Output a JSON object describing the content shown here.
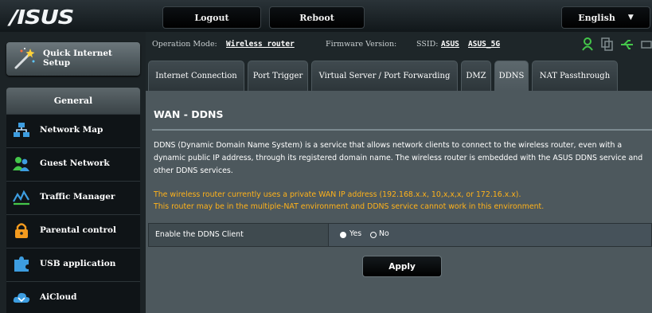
{
  "header": {
    "logo_text": "/ISUS",
    "logout_label": "Logout",
    "reboot_label": "Reboot",
    "language_label": "English",
    "language_arrow": "▼"
  },
  "sidebar": {
    "quick_setup_label": "Quick Internet Setup",
    "section_title": "General",
    "items": [
      {
        "label": "Network Map",
        "icon": "network-map-icon"
      },
      {
        "label": "Guest Network",
        "icon": "guest-network-icon"
      },
      {
        "label": "Traffic Manager",
        "icon": "traffic-manager-icon"
      },
      {
        "label": "Parental control",
        "icon": "parental-control-icon"
      },
      {
        "label": "USB application",
        "icon": "usb-application-icon"
      },
      {
        "label": "AiCloud",
        "icon": "aicloud-icon"
      }
    ]
  },
  "status": {
    "operation_mode_label": "Operation Mode:",
    "operation_mode_value": "Wireless router",
    "firmware_label": "Firmware Version:",
    "ssid_label": "SSID:",
    "ssid_value_1": "ASUS",
    "ssid_value_2": "ASUS_5G"
  },
  "tabs": [
    {
      "label": "Internet Connection",
      "active": false
    },
    {
      "label": "Port Trigger",
      "active": false
    },
    {
      "label": "Virtual Server / Port Forwarding",
      "active": false
    },
    {
      "label": "DMZ",
      "active": false
    },
    {
      "label": "DDNS",
      "active": true
    },
    {
      "label": "NAT Passthrough",
      "active": false
    }
  ],
  "panel": {
    "title": "WAN - DDNS",
    "description": "DDNS (Dynamic Domain Name System) is a service that allows network clients to connect to the wireless router, even with a dynamic public IP address, through its registered domain name. The wireless router is embedded with the ASUS DDNS service and other DDNS services.",
    "warning_line_1": "The wireless router currently uses a private WAN IP address (192.168.x.x, 10,x,x,x, or 172.16.x.x).",
    "warning_line_2": "This router may be in the multiple-NAT environment and DDNS service cannot work in this environment.",
    "enable_label": "Enable the DDNS Client",
    "option_yes": "Yes",
    "option_no": "No",
    "selected_option": "Yes",
    "apply_label": "Apply"
  },
  "colors": {
    "warning_text": "#ffb21a",
    "panel_bg": "#4d585d",
    "sidebar_bg": "#1c2326",
    "icon_green": "#44c64a",
    "icon_orange": "#f39b1f",
    "icon_blue": "#3d9de0"
  }
}
